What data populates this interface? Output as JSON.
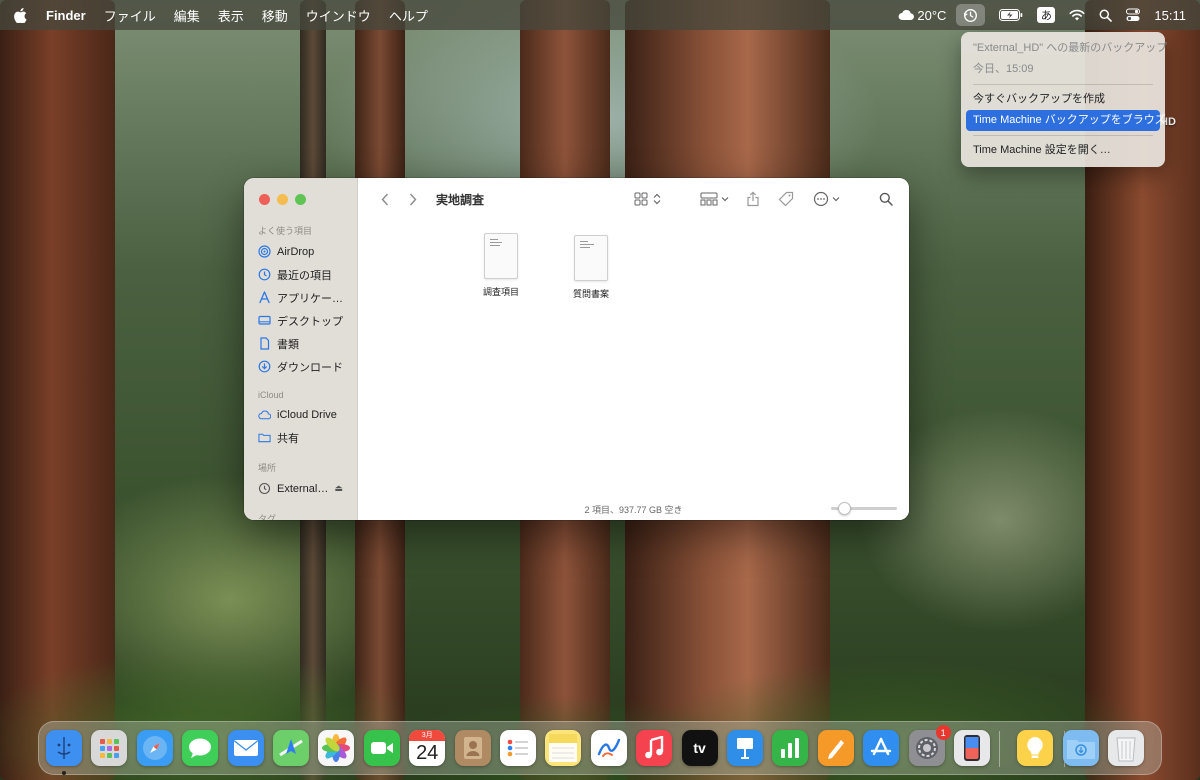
{
  "menubar": {
    "app_name": "Finder",
    "menus": [
      "ファイル",
      "編集",
      "表示",
      "移動",
      "ウインドウ",
      "ヘルプ"
    ],
    "weather": "20°C",
    "ime": "あ",
    "clock": "15:11",
    "icons": [
      "apple-icon",
      "weather-cloud-icon",
      "time-machine-icon",
      "battery-icon",
      "ime-icon",
      "wifi-icon",
      "search-icon",
      "control-center-icon"
    ]
  },
  "time_machine_menu": {
    "header": "\"External_HD\" への最新のバックアップ",
    "latest_time": "今日、15:09",
    "backup_now": "今すぐバックアップを作成",
    "browse": "Time Machine バックアップをブラウズ",
    "open_settings": "Time Machine 設定を開く…",
    "selected": "browse"
  },
  "desktop": {
    "volume_label_fragment": "HD"
  },
  "finder": {
    "title": "実地調査",
    "sidebar": {
      "favorites_title": "よく使う項目",
      "favorites": [
        {
          "label": "AirDrop",
          "icon": "airdrop-icon"
        },
        {
          "label": "最近の項目",
          "icon": "clock-icon"
        },
        {
          "label": "アプリケー…",
          "icon": "applications-icon"
        },
        {
          "label": "デスクトップ",
          "icon": "desktop-icon"
        },
        {
          "label": "書類",
          "icon": "document-icon"
        },
        {
          "label": "ダウンロード",
          "icon": "download-icon"
        }
      ],
      "icloud_title": "iCloud",
      "icloud": [
        {
          "label": "iCloud Drive",
          "icon": "cloud-icon"
        },
        {
          "label": "共有",
          "icon": "shared-folder-icon"
        }
      ],
      "locations_title": "場所",
      "locations": [
        {
          "label": "External…",
          "icon": "time-machine-icon",
          "eject": "⏏"
        }
      ],
      "tags_title": "タグ"
    },
    "files": [
      {
        "name": "調査項目",
        "icon": "text-document-icon"
      },
      {
        "name": "質問書案",
        "icon": "text-document-icon"
      }
    ],
    "status": "2 項目、937.77 GB 空き",
    "icon_size": 0.2
  },
  "dock": {
    "apps": [
      {
        "name": "Finder",
        "icon": "finder-icon",
        "color": "#3d8ff0",
        "running": true
      },
      {
        "name": "Launchpad",
        "icon": "launchpad-icon",
        "color": "#d8d8d8"
      },
      {
        "name": "Safari",
        "icon": "safari-icon",
        "color": "#3a9cf2"
      },
      {
        "name": "メッセージ",
        "icon": "messages-icon",
        "color": "#3fce57"
      },
      {
        "name": "メール",
        "icon": "mail-icon",
        "color": "#3b8ff1"
      },
      {
        "name": "マップ",
        "icon": "maps-icon",
        "color": "#6ccf6a"
      },
      {
        "name": "写真",
        "icon": "photos-icon",
        "color": "#f7f7f7"
      },
      {
        "name": "FaceTime",
        "icon": "facetime-icon",
        "color": "#37c24c"
      },
      {
        "name": "カレンダー",
        "icon": "calendar-icon",
        "color": "#ffffff",
        "month": "3月",
        "day": "24"
      },
      {
        "name": "連絡先",
        "icon": "contacts-icon",
        "color": "#b08a63"
      },
      {
        "name": "リマインダー",
        "icon": "reminders-icon",
        "color": "#ffffff"
      },
      {
        "name": "メモ",
        "icon": "notes-icon",
        "color": "#fbe57a"
      },
      {
        "name": "フリーボード",
        "icon": "freeform-icon",
        "color": "#ffffff"
      },
      {
        "name": "ミュージック",
        "icon": "music-icon",
        "color": "#f5424f"
      },
      {
        "name": "TV",
        "icon": "tv-icon",
        "color": "#111111",
        "label": "tv"
      },
      {
        "name": "Keynote",
        "icon": "keynote-icon",
        "color": "#2f8fe8"
      },
      {
        "name": "Numbers",
        "icon": "numbers-icon",
        "color": "#35b447"
      },
      {
        "name": "Pages",
        "icon": "pages-icon",
        "color": "#f59a28"
      },
      {
        "name": "App Store",
        "icon": "app-store-icon",
        "color": "#2f8ef0"
      },
      {
        "name": "システム設定",
        "icon": "system-settings-icon",
        "color": "#8e8e93",
        "badge": "1"
      },
      {
        "name": "iPhone ミラーリング",
        "icon": "iphone-mirroring-icon",
        "color": "#e8e8ea"
      },
      {
        "name": "ヒント",
        "icon": "tips-icon",
        "color": "#fbd24a"
      },
      {
        "name": "ダウンロード",
        "icon": "downloads-folder-icon",
        "color": "#7dbbf0"
      },
      {
        "name": "ゴミ箱",
        "icon": "trash-icon",
        "color": "#e6e8ea"
      }
    ]
  }
}
